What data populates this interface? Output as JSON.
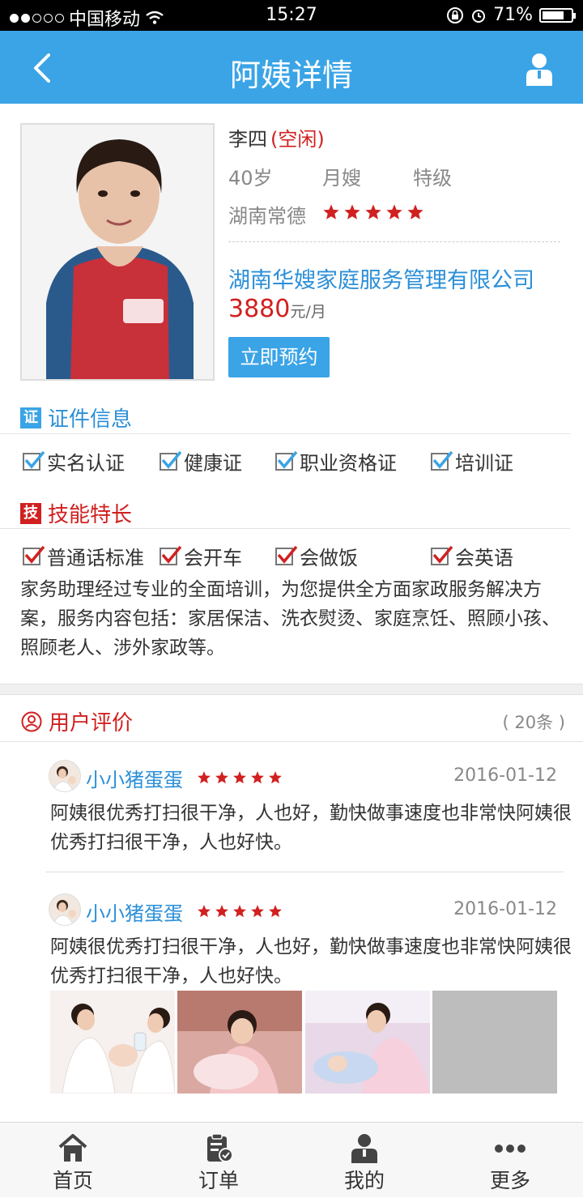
{
  "status_bar": {
    "carrier": "中国移动",
    "time": "15:27",
    "battery": "71%"
  },
  "nav": {
    "title": "阿姨详情",
    "back_icon": "chevron-left-icon",
    "user_icon": "user-icon"
  },
  "profile": {
    "name": "李四",
    "status": "(空闲)",
    "age": "40岁",
    "role": "月嫂",
    "level": "特级",
    "location": "湖南常德",
    "rating": 5,
    "company": "湖南华嫂家庭服务管理有限公司",
    "price": "3880",
    "price_unit": "元/月",
    "book_label": "立即预约"
  },
  "certificates": {
    "icon_text": "证",
    "title": "证件信息",
    "items": [
      "实名认证",
      "健康证",
      "职业资格证",
      "培训证"
    ]
  },
  "skills": {
    "icon_text": "技",
    "title": "技能特长",
    "items": [
      "普通话标准",
      "会开车",
      "会做饭",
      "会英语"
    ],
    "description": "家务助理经过专业的全面培训，为您提供全方面家政服务解决方案，服务内容包括：家居保洁、洗衣熨烫、家庭烹饪、照顾小孩、照顾老人、涉外家政等。"
  },
  "reviews": {
    "title": "用户评价",
    "count": "( 20条 )",
    "items": [
      {
        "user": "小小猪蛋蛋",
        "rating": 5,
        "date": "2016-01-12",
        "text": "阿姨很优秀打扫很干净，人也好，勤快做事速度也非常快阿姨很优秀打扫很干净，人也好快。"
      },
      {
        "user": "小小猪蛋蛋",
        "rating": 5,
        "date": "2016-01-12",
        "text": "阿姨很优秀打扫很干净，人也好，勤快做事速度也非常快阿姨很优秀打扫很干净，人也好快。"
      }
    ]
  },
  "tabbar": {
    "items": [
      "首页",
      "订单",
      "我的",
      "更多"
    ]
  },
  "colors": {
    "primary": "#3aa4e6",
    "accent_red": "#d12020",
    "link_blue": "#2b8fd8"
  }
}
